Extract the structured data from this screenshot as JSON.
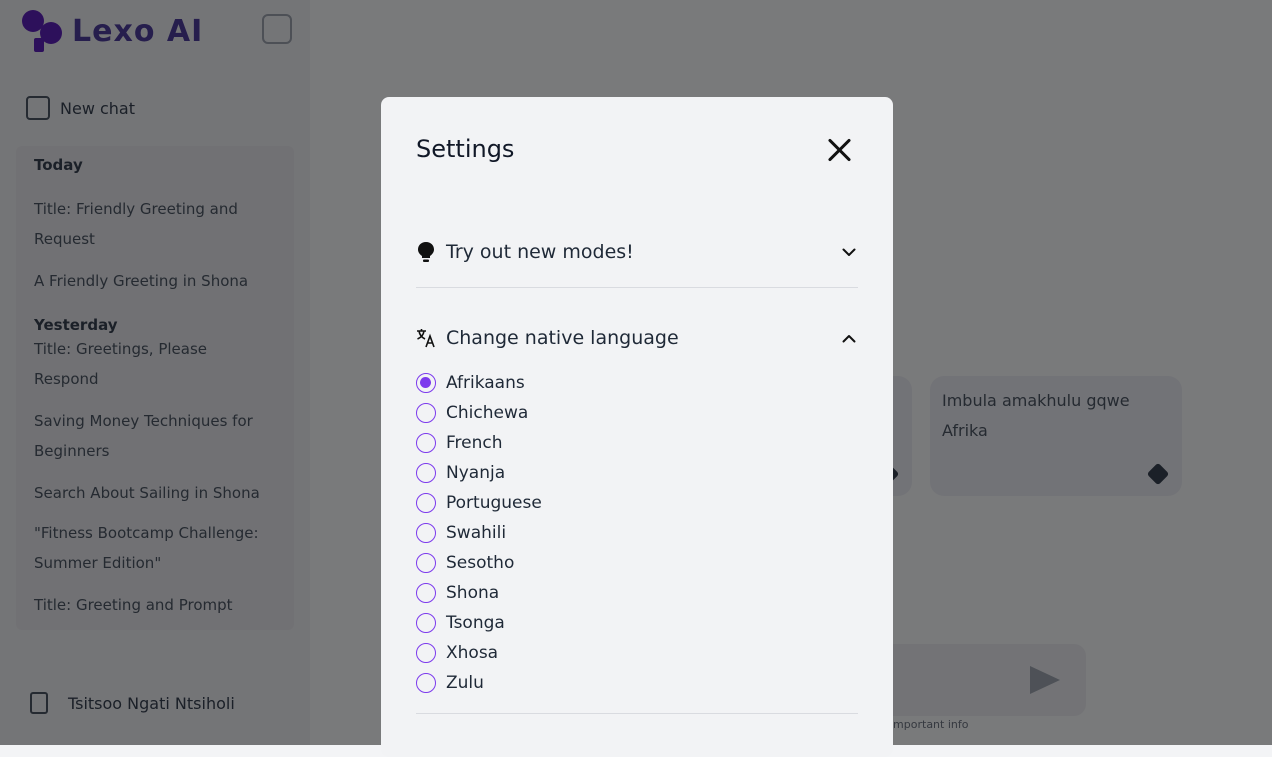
{
  "app": {
    "name": "Lexo AI"
  },
  "sidebar": {
    "new_chat": "New chat",
    "groups": [
      {
        "label": "Today",
        "items": [
          "Title: Friendly Greeting and Request",
          "A Friendly Greeting in Shona"
        ]
      },
      {
        "label": "Yesterday",
        "items": [
          "Title: Greetings, Please Respond",
          "Saving Money Techniques for Beginners",
          "Search About Sailing in Shona",
          "\"Fitness Bootcamp Challenge: Summer Edition\"",
          "Title: Greeting and Prompt"
        ]
      }
    ],
    "user": "Tsitsoo Ngati Ntsiholi"
  },
  "main": {
    "card_right": "Imbula amakhulu gqwe Afrika",
    "footnote": "important info"
  },
  "modal": {
    "title": "Settings",
    "sections": [
      {
        "label": "Try out new modes!",
        "expanded": false
      },
      {
        "label": "Change native language",
        "expanded": true
      }
    ],
    "languages": [
      "Afrikaans",
      "Chichewa",
      "French",
      "Nyanja",
      "Portuguese",
      "Swahili",
      "Sesotho",
      "Shona",
      "Tsonga",
      "Xhosa",
      "Zulu"
    ],
    "selected_language": "Afrikaans"
  },
  "colors": {
    "accent": "#7c3aed",
    "brand": "#4c3c9a"
  }
}
